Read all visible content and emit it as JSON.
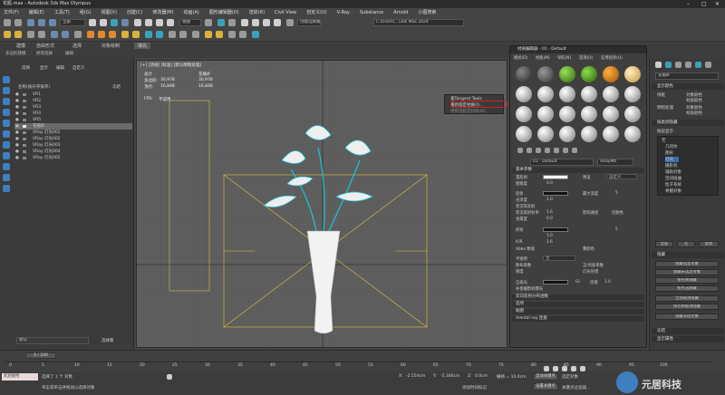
{
  "window": {
    "title": "花瓶.max - Autodesk 3ds Max Olympus"
  },
  "menu": [
    "文件(F)",
    "编辑(E)",
    "工具(T)",
    "组(G)",
    "视图(V)",
    "创建(C)",
    "修改器(M)",
    "动画(A)",
    "图形编辑器(D)",
    "渲染(R)",
    "Civil View",
    "自定义(U)",
    "V-Ray",
    "Substance",
    "Arnold",
    "小图搜索"
  ],
  "toolbar": {
    "filter": "全部",
    "view": "视图",
    "selection_set": "创建选择集",
    "workspace": "C:\\Users\\...\\3ds Max 2024"
  },
  "ribbon": {
    "tabs": [
      "建模",
      "自由形式",
      "选择",
      "对象绘制",
      "填充"
    ],
    "subs": [
      "多边形建模",
      "修改选择",
      "编辑"
    ]
  },
  "scene_explorer": {
    "tabs": [
      "选择",
      "显示",
      "编辑",
      "自定义"
    ],
    "column_header": "名称(按升序排序)",
    "frozen_header": "冻结",
    "rows": [
      "VR1",
      "VR2",
      "VR3",
      "VR4",
      "VR5",
      "花瓶Ø",
      "VRay 灯光001",
      "VRay 灯光002",
      "VRay 灯光003",
      "VRay 灯光004",
      "VRay 灯光005"
    ],
    "selected_index": 5,
    "layer": "默认",
    "layer_btn": "选择集"
  },
  "viewport": {
    "label": "[+] [顶视] [标准] [默认明暗处理]",
    "stats": {
      "col1": "总计",
      "col2": "花瓶Ø",
      "poly_label": "多边形:",
      "poly_total": "30,978",
      "poly_sel": "30,978",
      "vert_label": "顶点:",
      "vert_total": "16,848",
      "vert_sel": "16,848",
      "fps_label": "FPS:",
      "fps_value": "不适用"
    }
  },
  "context_menu": {
    "items": [
      "查Tangent Tools",
      "重新指定材质(I)...",
      "用所选指定材质(M)"
    ],
    "highlighted": 1
  },
  "material_editor": {
    "title": "材质编辑器 - 01 - Default",
    "menus": [
      "模式(D)",
      "材质(M)",
      "导航(N)",
      "选项(O)",
      "实用程序(U)"
    ],
    "material_name": "01 - Default",
    "material_type": "VRayMtl",
    "sections": {
      "basic": "基本参数",
      "bump": "凹凸贴图",
      "reflect": "反射",
      "refract": "折射",
      "fog": "半透明",
      "selfillum": "自发光",
      "bidirectional": "双向反射分布函数",
      "options": "选项",
      "maps": "贴图",
      "vray_props": "mental ray 连接"
    },
    "params": {
      "diffuse": "漫反射",
      "roughness": "粗糙度",
      "roughness_val": "0.0",
      "preset": "预设",
      "preset_val": "自定义",
      "reflect": "反射",
      "max_depth": "最大深度",
      "max_depth_val": "5",
      "gloss": "光泽度",
      "gloss_val": "1.0",
      "fresnel": "菲涅耳反射",
      "fresnel_ior": "菲涅耳折射率",
      "fresnel_ior_val": "1.6",
      "metalness": "金属度",
      "metalness_val": "0.0",
      "exit_color": "退出颜色",
      "dim_dist": "暗淡距离",
      "affect_ch": "影响通道",
      "affect_ch_val": "仅颜色",
      "refract": "折射",
      "ref_max_depth_val": "5",
      "ref_gloss_val": "1.0",
      "ior": "IOR",
      "ior_val": "1.6",
      "abbe": "Abbe 数值",
      "fog_color": "雾颜色",
      "fog_mult": "雾倍增",
      "fog_bias": "雾偏移",
      "translucency": "半透明",
      "trans_val": "无",
      "scatter": "散布系数",
      "fwd": "正/背面系数",
      "thickness": "厚度",
      "light_mult": "灯光倍增",
      "self_illum": "自发光",
      "gi": "GI",
      "mult": "倍增",
      "mult_val": "1.0",
      "compensate": "补偿摄影机曝光",
      "brdf": "微面 GTR (GGX)",
      "aniso": "各向异性",
      "rotation": "旋转"
    }
  },
  "command_panel": {
    "object_name": "花瓶Ø",
    "display_section": "显示颜色",
    "wire": "线框",
    "wire_opt": "对象颜色",
    "shaded": "明暗处理",
    "shaded_opt": "对象颜色",
    "mat_opt": "材质颜色",
    "by_layer": "按层显示",
    "hide_section": "按类别隐藏",
    "hide_items": [
      "几何体",
      "图形",
      "灯光",
      "摄影机",
      "辅助对象",
      "空间扭曲",
      "粒子系统",
      "骨骼对象"
    ],
    "none_label": "无",
    "all_label": "全部",
    "invert_label": "反转",
    "hide_obj_section": "隐藏",
    "hide_btns": [
      "隐藏选定对象",
      "隐藏未选定对象",
      "按名称隐藏",
      "按点击隐藏",
      "全部取消隐藏",
      "按名称取消隐藏",
      "隐藏冻结对象"
    ],
    "freeze_section": "冻结",
    "display_props": "显示属性"
  },
  "timeline": {
    "frame": "0 / 100",
    "ticks": [
      "0",
      "5",
      "10",
      "15",
      "20",
      "25",
      "30",
      "35",
      "40",
      "45",
      "50",
      "55",
      "60",
      "65",
      "70",
      "75",
      "80",
      "85",
      "90",
      "95",
      "100"
    ]
  },
  "status": {
    "script_box": "欢迎使用 MAXScript",
    "selected": "选择了 1 个 对象",
    "hint": "单击或单击并拖动以选择对象",
    "x_label": "X:",
    "x_val": "-2.554cm",
    "y_label": "Y:",
    "y_val": "-5.346cm",
    "z_label": "Z:",
    "z_val": "0.0cm",
    "grid": "栅格 = 10.0cm",
    "add_time_tag": "添加时间标记",
    "auto_key": "自动关键点",
    "set_key": "设置关键点",
    "selected_obj": "选定对象",
    "key_filter": "关键点过滤器...",
    "watermark": "元居科技"
  }
}
